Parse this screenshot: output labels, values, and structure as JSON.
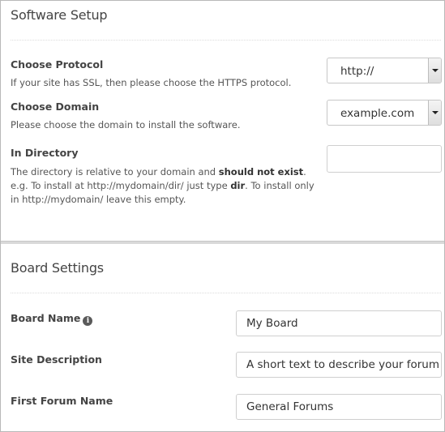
{
  "software_setup": {
    "title": "Software Setup",
    "protocol": {
      "label": "Choose Protocol",
      "help": "If your site has SSL, then please choose the HTTPS protocol.",
      "selected": "http://"
    },
    "domain": {
      "label": "Choose Domain",
      "help": "Please choose the domain to install the software.",
      "selected": "example.com"
    },
    "directory": {
      "label": "In Directory",
      "help_part1": "The directory is relative to your domain and ",
      "help_bold1": "should not exist",
      "help_part2": ". e.g. To install at http://mydomain/dir/ just type ",
      "help_bold2": "dir",
      "help_part3": ". To install only in http://mydomain/ leave this empty.",
      "value": ""
    }
  },
  "board_settings": {
    "title": "Board Settings",
    "board_name": {
      "label": "Board Name",
      "info_icon": "i",
      "value": "My Board"
    },
    "site_description": {
      "label": "Site Description",
      "value": "A short text to describe your forum"
    },
    "first_forum_name": {
      "label": "First Forum Name",
      "value": "General Forums"
    }
  },
  "icons": {
    "dropdown": "chevron-down-icon",
    "info": "info-icon"
  }
}
